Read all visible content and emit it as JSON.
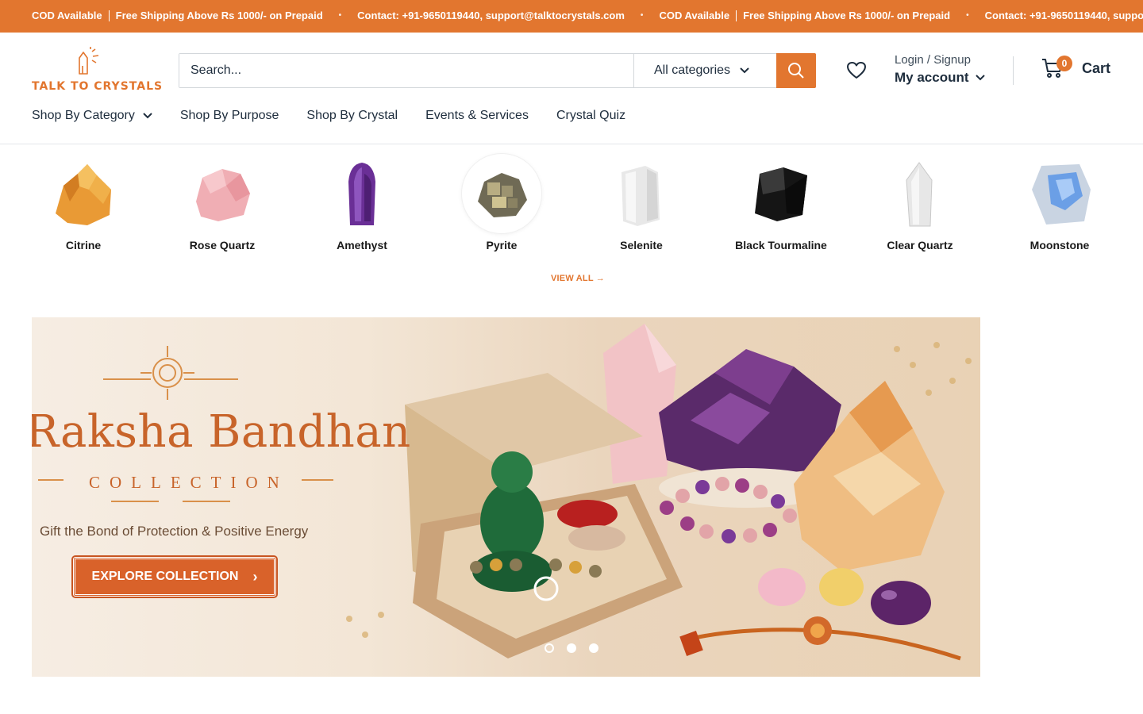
{
  "announcement": {
    "cod": "COD Available",
    "shipping": "Free Shipping Above Rs 1000/- on Prepaid",
    "contact": "Contact: +91-9650119440, support@talktocrystals.com"
  },
  "header": {
    "logo_text": "TALK TO CRYSTALS",
    "search": {
      "placeholder": "Search...",
      "category": "All categories"
    },
    "account": {
      "login": "Login / Signup",
      "my_account": "My account"
    },
    "cart": {
      "count": "0",
      "label": "Cart"
    },
    "nav": [
      {
        "label": "Shop By Category"
      },
      {
        "label": "Shop By Purpose"
      },
      {
        "label": "Shop By Crystal"
      },
      {
        "label": "Events & Services"
      },
      {
        "label": "Crystal Quiz"
      }
    ]
  },
  "crystals": {
    "items": [
      {
        "name": "Citrine"
      },
      {
        "name": "Rose Quartz"
      },
      {
        "name": "Amethyst"
      },
      {
        "name": "Pyrite"
      },
      {
        "name": "Selenite"
      },
      {
        "name": "Black Tourmaline"
      },
      {
        "name": "Clear Quartz"
      },
      {
        "name": "Moonstone"
      }
    ],
    "view_all": "VIEW ALL →"
  },
  "banner": {
    "heading": "Raksha Bandhan",
    "subheading": "COLLECTION",
    "tagline": "Gift the Bond of Protection & Positive Energy",
    "cta": "EXPLORE COLLECTION",
    "slides_total": 3,
    "slide_active": 1
  },
  "colors": {
    "brand": "#e2762f",
    "text": "#1e2d3d"
  }
}
